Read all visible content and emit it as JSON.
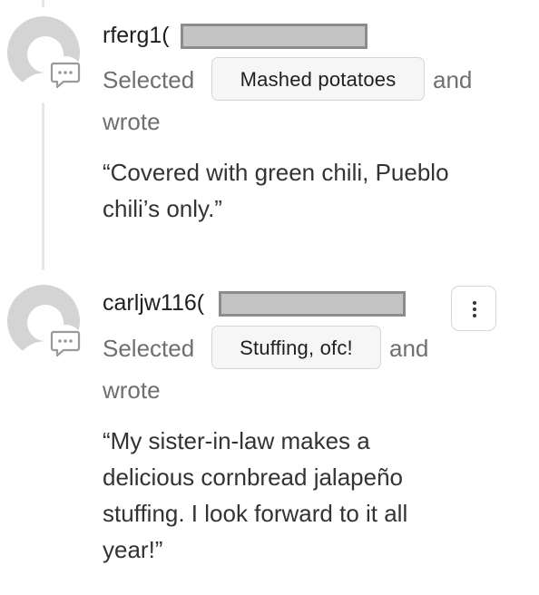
{
  "comments": [
    {
      "username": "rferg1(",
      "selected_prefix": "Selected",
      "choice": "Mashed potatoes",
      "selected_suffix": "and",
      "wrote": "wrote",
      "text": "“Covered with green chili, Pueblo\nchili’s only.”",
      "avatar_icon": "default-user-avatar",
      "badge_icon": "chat-bubble-icon"
    },
    {
      "username": "carljw116(",
      "selected_prefix": "Selected",
      "choice": "Stuffing, ofc!",
      "selected_suffix": "and",
      "wrote": "wrote",
      "text": "“My sister-in-law makes a\ndelicious cornbread jalapeño\nstuffing. I look forward to it all\nyear!”",
      "avatar_icon": "default-user-avatar",
      "badge_icon": "chat-bubble-icon",
      "more_icon": "vertical-ellipsis-icon"
    }
  ],
  "colors": {
    "avatar_gray": "#d4d4d4",
    "redaction_fill": "#c4c4c4",
    "redaction_border": "#8c8c8c",
    "thread_line": "#e5e5e5",
    "chip_background": "#f6f6f6"
  }
}
